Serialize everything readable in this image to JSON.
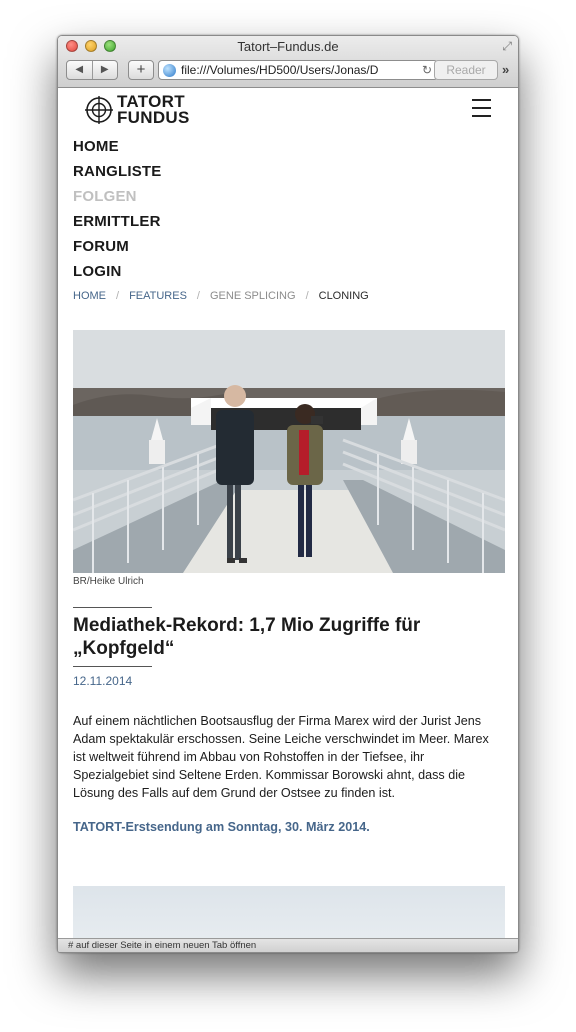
{
  "browser": {
    "window_title": "Tatort–Fundus.de",
    "back_label": "◀",
    "forward_label": "▶",
    "add_label": "+",
    "url": "file:///Volumes/HD500/Users/Jonas/D",
    "reload_label": "↻",
    "reader_label": "Reader",
    "more_label": "»",
    "status_text": "# auf dieser Seite in einem neuen Tab öffnen"
  },
  "site": {
    "logo_line1": "TATORT",
    "logo_line2": "FUNDUS"
  },
  "nav": {
    "items": [
      {
        "label": "HOME"
      },
      {
        "label": "RANGLISTE"
      },
      {
        "label": "FOLGEN",
        "active": true
      },
      {
        "label": "ERMITTLER"
      },
      {
        "label": "FORUM"
      },
      {
        "label": "LOGIN"
      }
    ]
  },
  "breadcrumb": {
    "items": [
      {
        "label": "HOME"
      },
      {
        "label": "FEATURES"
      },
      {
        "label": "GENE SPLICING"
      },
      {
        "label": "CLONING"
      }
    ],
    "separator": "/"
  },
  "article": {
    "image_caption": "BR/Heike Ulrich",
    "headline": "Mediathek-Rekord: 1,7 Mio Zugriffe für „Kopfgeld“",
    "date": "12.11.2014",
    "body": "Auf einem nächtlichen Bootsausflug der Firma Marex wird der Jurist Jens Adam spektakulär erschossen. Seine Leiche verschwindet im Meer. Marex ist weltweit führend im Abbau von Rohstoffen in der Tiefsee, ihr Spezialgebiet sind Seltene Erden. Kommissar Borowski ahnt, dass die Lösung des Falls auf dem Grund der Ostsee zu finden ist.",
    "premiere": "TATORT-Erstsendung am Sonntag, 30. März 2014."
  },
  "colors": {
    "link_blue": "#46668a",
    "nav_active": "#c0c0c0",
    "text": "#1b1b1b"
  }
}
